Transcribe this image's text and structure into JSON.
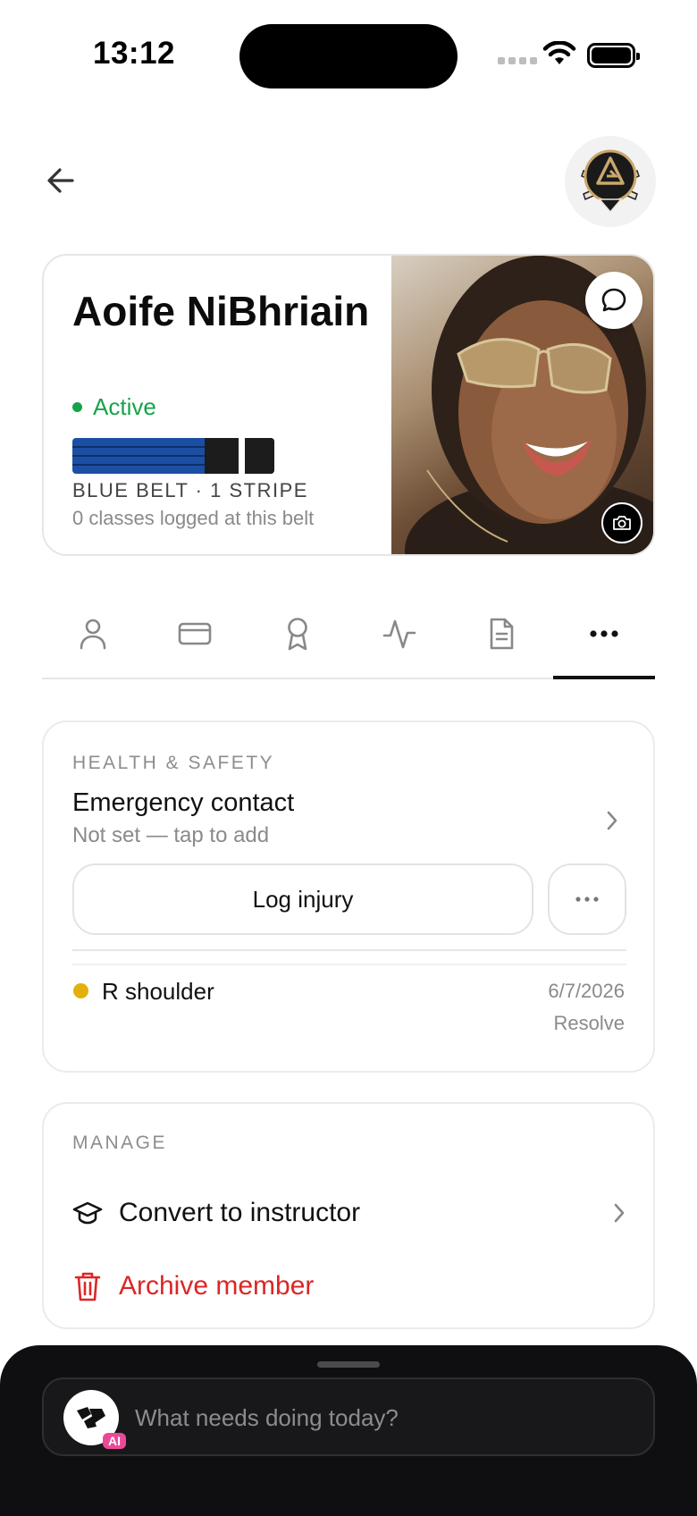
{
  "status_bar": {
    "time": "13:12"
  },
  "header": {
    "back_icon": "arrow-left-icon",
    "logo": "gym-logo"
  },
  "profile": {
    "name": "Aoife NiBhriain",
    "status": "Active",
    "status_color": "#16a34a",
    "belt_color": "#1b4fa3",
    "belt_label": "BLUE BELT · 1 STRIPE",
    "stripes": 1,
    "classes_note": "0 classes logged at this belt",
    "message_icon": "chat-bubble-icon",
    "camera_icon": "camera-icon"
  },
  "tabs": [
    {
      "icon": "person-icon",
      "active": false
    },
    {
      "icon": "credit-card-icon",
      "active": false
    },
    {
      "icon": "award-ribbon-icon",
      "active": false
    },
    {
      "icon": "activity-icon",
      "active": false
    },
    {
      "icon": "document-icon",
      "active": false
    },
    {
      "icon": "more-horizontal-icon",
      "active": true
    }
  ],
  "health": {
    "section_label": "HEALTH & SAFETY",
    "emergency_title": "Emergency contact",
    "emergency_sub": "Not set — tap to add",
    "log_injury_label": "Log injury",
    "injury": {
      "name": "R shoulder",
      "date": "6/7/2026",
      "action": "Resolve",
      "status_color": "#e3b00b"
    }
  },
  "manage": {
    "section_label": "MANAGE",
    "convert_label": "Convert to instructor",
    "archive_label": "Archive member",
    "archive_color": "#dc2626"
  },
  "assistant": {
    "placeholder": "What needs doing today?",
    "badge": "AI"
  }
}
